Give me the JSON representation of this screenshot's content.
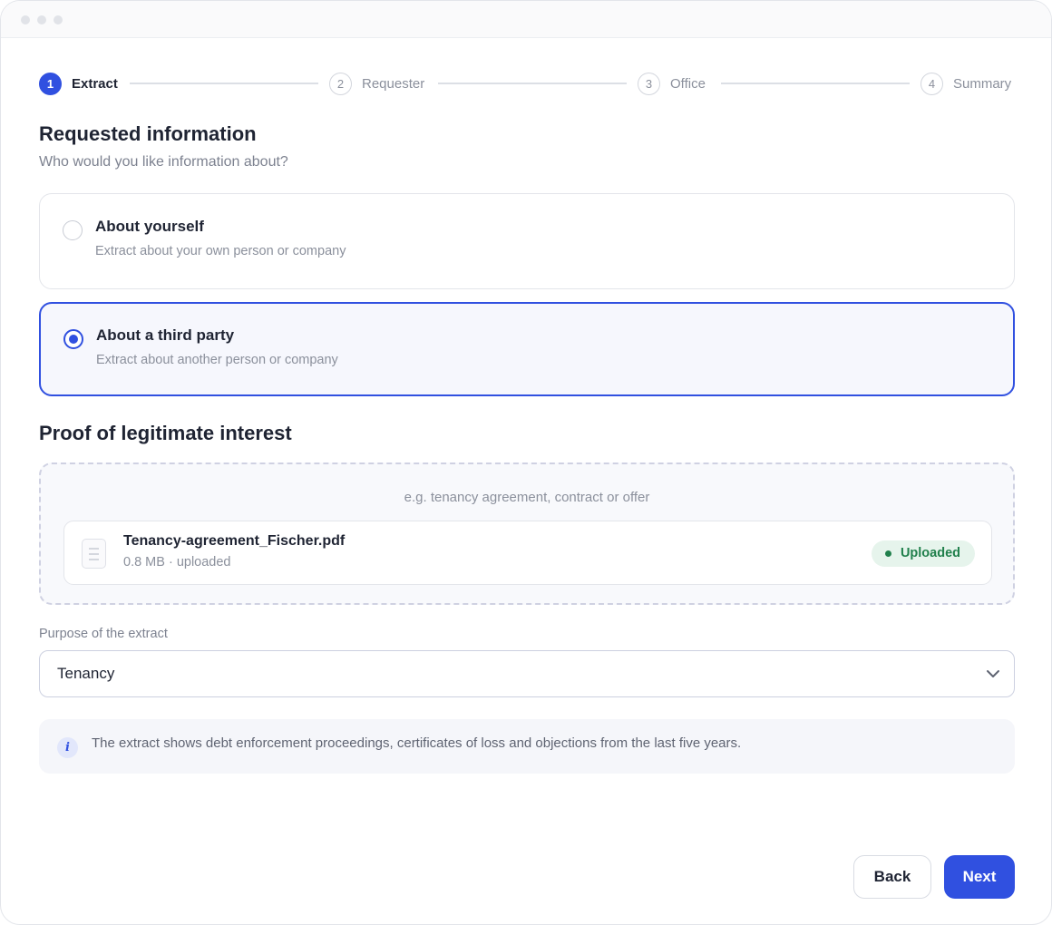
{
  "stepper": {
    "steps": [
      {
        "number": "1",
        "label": "Extract",
        "state": "active"
      },
      {
        "number": "2",
        "label": "Requester",
        "state": "upcoming"
      },
      {
        "number": "3",
        "label": "Office",
        "state": "upcoming"
      },
      {
        "number": "4",
        "label": "Summary",
        "state": "upcoming"
      }
    ]
  },
  "requested_info": {
    "title": "Requested information",
    "subtitle": "Who would you like information about?",
    "options": [
      {
        "title": "About yourself",
        "description": "Extract about your own person or company",
        "selected": false
      },
      {
        "title": "About a third party",
        "description": "Extract about another person or company",
        "selected": true
      }
    ]
  },
  "proof": {
    "title": "Proof of legitimate interest",
    "hint": "e.g. tenancy agreement, contract or offer",
    "file": {
      "name": "Tenancy-agreement_Fischer.pdf",
      "meta": "0.8 MB · uploaded",
      "status": "Uploaded"
    }
  },
  "purpose": {
    "label": "Purpose of the extract",
    "value": "Tenancy"
  },
  "info": {
    "icon": "i",
    "text": "The extract shows debt enforcement proceedings, certificates of loss and objections from the last five years."
  },
  "actions": {
    "back_label": "Back",
    "next_label": "Next"
  },
  "colors": {
    "accent": "#3050e0",
    "success": "#21804c",
    "success_bg": "#e6f4ec"
  }
}
